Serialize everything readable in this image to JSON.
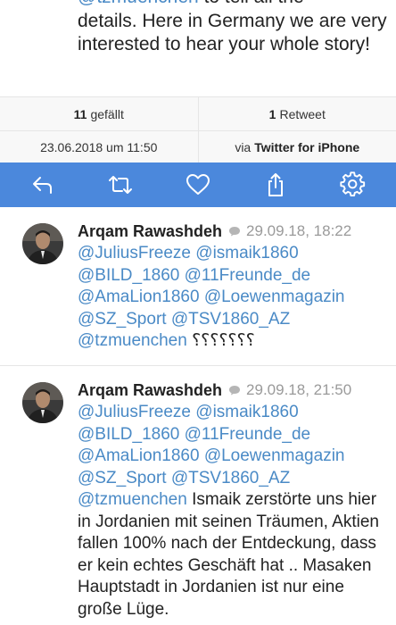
{
  "tweet": {
    "mention_line": "@tzmuenchen",
    "text_after_mention": " to tell all the",
    "body": "details. Here in Germany we are very interested to hear your whole story!"
  },
  "stats": {
    "likes_count": "11",
    "likes_label": "gefällt",
    "retweets_count": "1",
    "retweets_label": "Retweet"
  },
  "meta": {
    "datetime": "23.06.2018 um 11:50",
    "via_prefix": "via",
    "client": "Twitter for iPhone"
  },
  "actions": {
    "accent_color": "#4b88dc",
    "icons": [
      "reply-icon",
      "retweet-icon",
      "heart-icon",
      "share-icon",
      "gear-icon"
    ]
  },
  "replies": [
    {
      "author": "Arqam Rawashdeh",
      "timestamp": "29.09.18, 18:22",
      "mentions": "@JuliusFreeze @ismaik1860 @BILD_1860 @11Freunde_de @AmaLion1860 @Loewenmagazin @SZ_Sport @TSV1860_AZ @tzmuenchen",
      "text": " ؟؟؟؟؟؟؟"
    },
    {
      "author": "Arqam Rawashdeh",
      "timestamp": "29.09.18, 21:50",
      "mentions": "@JuliusFreeze @ismaik1860 @BILD_1860 @11Freunde_de @AmaLion1860 @Loewenmagazin @SZ_Sport @TSV1860_AZ @tzmuenchen",
      "text": " Ismaik zerstörte uns hier in Jordanien mit seinen Träumen, Aktien fallen 100% nach der Entdeckung, dass er kein echtes Geschäft hat .. Masaken Hauptstadt in Jordanien ist nur eine große Lüge."
    }
  ]
}
